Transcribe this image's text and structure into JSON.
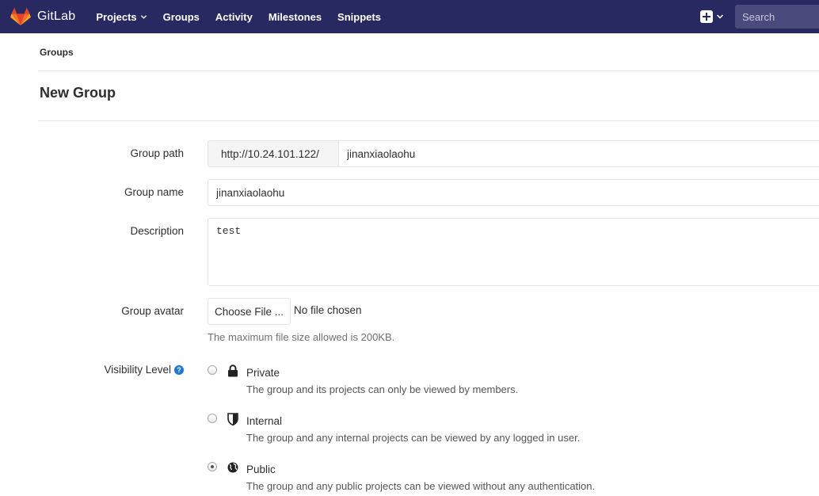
{
  "navbar": {
    "brand": "GitLab",
    "links": [
      "Projects",
      "Groups",
      "Activity",
      "Milestones",
      "Snippets"
    ],
    "search_placeholder": "Search",
    "colors": {
      "background": "#292961",
      "logo_orange": "#e24329",
      "logo_light": "#fca326"
    }
  },
  "breadcrumb": "Groups",
  "page_title": "New Group",
  "form": {
    "group_path": {
      "label": "Group path",
      "prefix": "http://10.24.101.122/",
      "value": "jinanxiaolaohu"
    },
    "group_name": {
      "label": "Group name",
      "value": "jinanxiaolaohu"
    },
    "description": {
      "label": "Description",
      "value": "test"
    },
    "group_avatar": {
      "label": "Group avatar",
      "button": "Choose File ...",
      "status": "No file chosen",
      "help": "The maximum file size allowed is 200KB."
    },
    "visibility": {
      "label": "Visibility Level",
      "help_icon": "?",
      "options": [
        {
          "title": "Private",
          "icon": "lock-icon",
          "description": "The group and its projects can only be viewed by members.",
          "checked": false
        },
        {
          "title": "Internal",
          "icon": "shield-icon",
          "description": "The group and any internal projects can be viewed by any logged in user.",
          "checked": false
        },
        {
          "title": "Public",
          "icon": "globe-icon",
          "description": "The group and any public projects can be viewed without any authentication.",
          "checked": true
        }
      ]
    }
  }
}
